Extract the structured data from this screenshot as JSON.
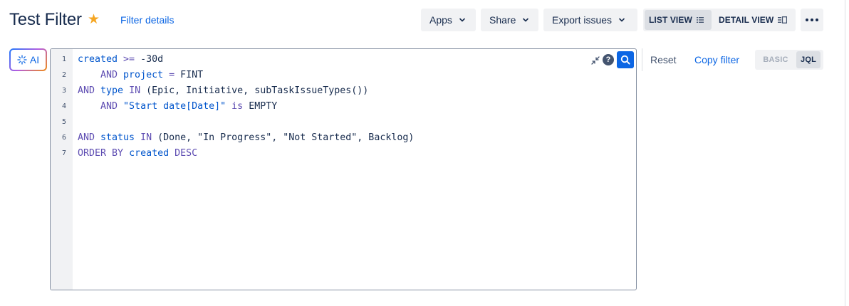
{
  "header": {
    "title": "Test Filter",
    "filter_details_label": "Filter details",
    "apps_label": "Apps",
    "share_label": "Share",
    "export_label": "Export issues",
    "list_view_label": "LIST VIEW",
    "detail_view_label": "DETAIL VIEW"
  },
  "search": {
    "ai_label": "AI",
    "reset_label": "Reset",
    "copy_filter_label": "Copy filter",
    "basic_label": "BASIC",
    "jql_label": "JQL"
  },
  "editor": {
    "line_numbers": [
      "1",
      "2",
      "3",
      "4",
      "5",
      "6",
      "7"
    ],
    "lines": [
      [
        {
          "t": "created",
          "c": "fld"
        },
        {
          "t": " >= ",
          "c": "op"
        },
        {
          "t": "-30d",
          "c": "plain"
        }
      ],
      [
        {
          "t": "    AND ",
          "c": "kw"
        },
        {
          "t": "project",
          "c": "fld"
        },
        {
          "t": " = ",
          "c": "op"
        },
        {
          "t": "FINT",
          "c": "plain"
        }
      ],
      [
        {
          "t": "AND ",
          "c": "kw"
        },
        {
          "t": "type",
          "c": "fld"
        },
        {
          "t": " IN ",
          "c": "op"
        },
        {
          "t": "(Epic, Initiative, subTaskIssueTypes())",
          "c": "plain"
        }
      ],
      [
        {
          "t": "    AND ",
          "c": "kw"
        },
        {
          "t": "\"Start date[Date]\"",
          "c": "fld"
        },
        {
          "t": " is ",
          "c": "op"
        },
        {
          "t": "EMPTY",
          "c": "plain"
        }
      ],
      [],
      [
        {
          "t": "AND ",
          "c": "kw"
        },
        {
          "t": "status",
          "c": "fld"
        },
        {
          "t": " IN ",
          "c": "op"
        },
        {
          "t": "(Done, \"In Progress\", \"Not Started\", Backlog)",
          "c": "plain"
        }
      ],
      [
        {
          "t": "ORDER BY ",
          "c": "kw"
        },
        {
          "t": "created",
          "c": "fld"
        },
        {
          "t": " DESC",
          "c": "kw"
        }
      ]
    ]
  },
  "colors": {
    "accent": "#0c66e4",
    "star": "#f5a623",
    "keyword": "#5e4db2",
    "field": "#0055cc"
  },
  "icons": {
    "star": "star-icon",
    "chevron": "chevron-down-icon",
    "list_view": "list-view-icon",
    "detail_view": "detail-view-icon",
    "more": "more-icon",
    "ai": "ai-sparkle-icon",
    "collapse": "collapse-icon",
    "help": "help-icon",
    "search": "search-icon"
  }
}
